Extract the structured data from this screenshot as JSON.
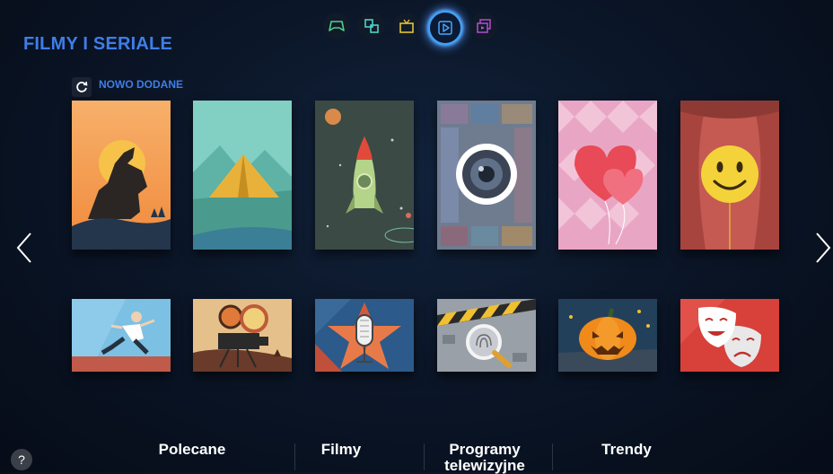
{
  "header": {
    "title": "FILMY I SERIALE",
    "nav_icons": [
      "gamepad-icon",
      "apps-icon",
      "tv-icon",
      "play-icon",
      "multimedia-icon"
    ],
    "active_icon": "play-icon",
    "accent": "#3f7ee8"
  },
  "section": {
    "label": "NOWO DODANE",
    "icon": "refresh-icon"
  },
  "tiles_top": [
    "rooster-sunset",
    "tent-mountains",
    "rocket-space",
    "camera-lens-collage",
    "heart-balloons",
    "smiley-balloon-curtain"
  ],
  "tiles_bottom": [
    "runner",
    "movie-camera",
    "microphone-star",
    "fingerprint-magnifier",
    "halloween-pumpkin",
    "theater-masks"
  ],
  "bottom_menu": {
    "items": [
      "Polecane",
      "Filmy",
      "Programy telewizyjne",
      "Trendy"
    ]
  },
  "help_label": "?"
}
